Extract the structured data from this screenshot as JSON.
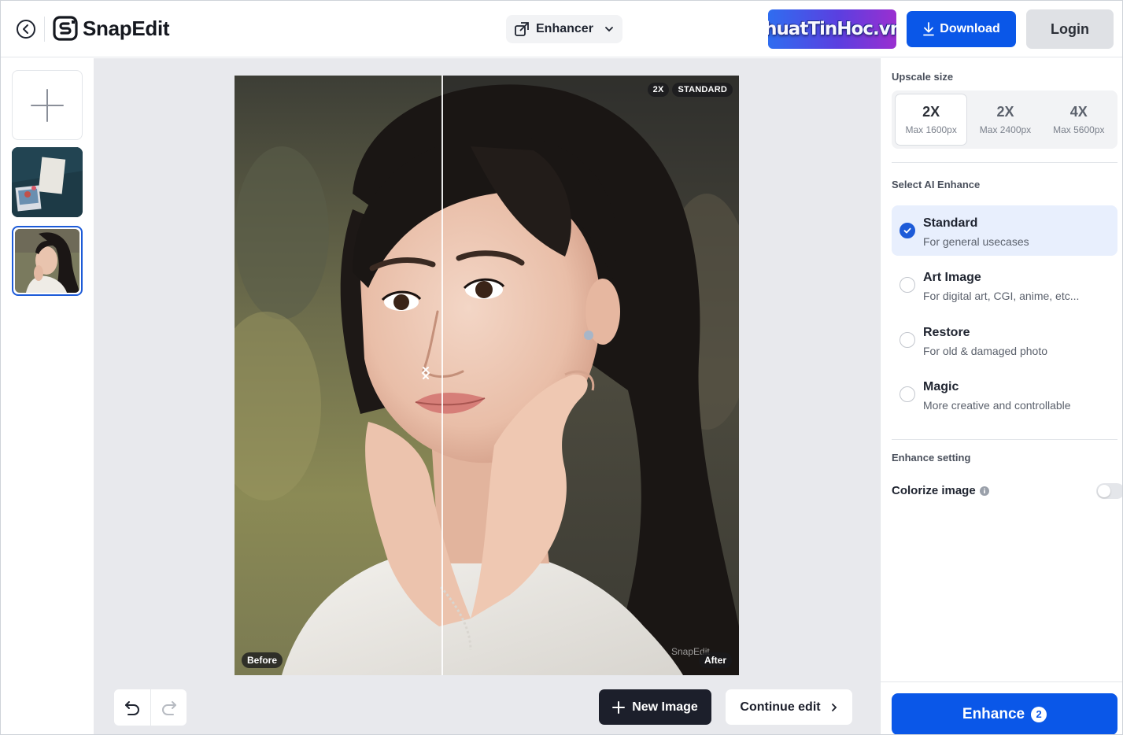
{
  "brand": {
    "name": "SnapEdit",
    "watermark_text": "ThuThuatTinHoc.vn"
  },
  "header": {
    "tool_select_value": "Enhancer",
    "download_label": "Download",
    "login_label": "Login"
  },
  "canvas": {
    "badges": [
      "2X",
      "STANDARD"
    ],
    "before_label": "Before",
    "after_label": "After",
    "photo_watermark": "SnapEdit"
  },
  "toolbar": {
    "new_image_label": "New Image",
    "continue_label": "Continue edit"
  },
  "panel": {
    "upscale_title": "Upscale size",
    "upscale_options": [
      {
        "scale": "2X",
        "max": "Max 1600px",
        "selected": true
      },
      {
        "scale": "2X",
        "max": "Max 2400px",
        "selected": false
      },
      {
        "scale": "4X",
        "max": "Max 5600px",
        "selected": false
      }
    ],
    "enhance_title": "Select AI Enhance",
    "enhance_options": [
      {
        "name": "Standard",
        "desc": "For general usecases",
        "selected": true
      },
      {
        "name": "Art Image",
        "desc": "For digital art, CGI, anime, etc...",
        "selected": false
      },
      {
        "name": "Restore",
        "desc": "For old & damaged photo",
        "selected": false
      },
      {
        "name": "Magic",
        "desc": "More creative and controllable",
        "selected": false
      }
    ],
    "setting_title": "Enhance setting",
    "colorize_label": "Colorize image",
    "colorize_on": false,
    "enhance_button_label": "Enhance",
    "enhance_credits": "2"
  },
  "colors": {
    "primary": "#0a57e8",
    "dark_button": "#1c1f2b",
    "selected_bg": "#e8effd",
    "canvas_bg": "#e8e9ed"
  }
}
